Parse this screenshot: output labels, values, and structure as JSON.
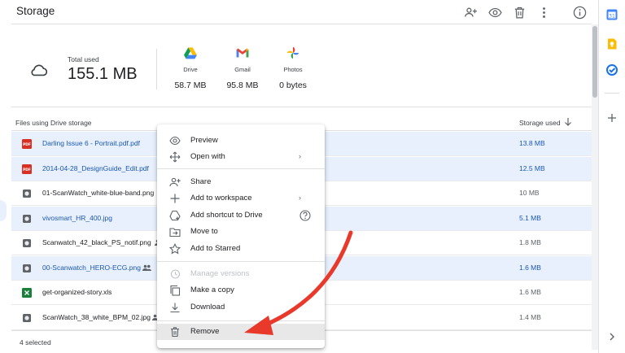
{
  "header": {
    "title": "Storage"
  },
  "summary": {
    "total_label": "Total used",
    "total_value": "155.1 MB",
    "services": [
      {
        "name": "Drive",
        "value": "58.7 MB",
        "icon": "google-drive-icon"
      },
      {
        "name": "Gmail",
        "value": "95.8 MB",
        "icon": "gmail-icon"
      },
      {
        "name": "Photos",
        "value": "0 bytes",
        "icon": "google-photos-icon"
      }
    ]
  },
  "table": {
    "col_files": "Files using Drive storage",
    "col_storage": "Storage used",
    "rows": [
      {
        "name": "Darling Issue 6 - Portrait.pdf.pdf",
        "size": "13.8 MB",
        "selected": true,
        "icon": "pdf-icon",
        "shared": false
      },
      {
        "name": "2014-04-28_DesignGuide_Edit.pdf",
        "size": "12.5 MB",
        "selected": true,
        "icon": "pdf-icon",
        "shared": false
      },
      {
        "name": "01-ScanWatch_white-blue-band.png",
        "size": "10 MB",
        "selected": false,
        "icon": "image-icon",
        "shared": true
      },
      {
        "name": "vivosmart_HR_400.jpg",
        "size": "5.1 MB",
        "selected": true,
        "icon": "image-icon",
        "shared": false
      },
      {
        "name": "Scanwatch_42_black_PS_notif.png",
        "size": "1.8 MB",
        "selected": false,
        "icon": "image-icon",
        "shared": true
      },
      {
        "name": "00-Scanwatch_HERO-ECG.png",
        "size": "1.6 MB",
        "selected": true,
        "icon": "image-icon",
        "shared": true
      },
      {
        "name": "get-organized-story.xls",
        "size": "1.6 MB",
        "selected": false,
        "icon": "sheets-icon",
        "shared": false
      },
      {
        "name": "ScanWatch_38_white_BPM_02.jpg",
        "size": "1.4 MB",
        "selected": false,
        "icon": "image-icon",
        "shared": true
      }
    ]
  },
  "status": {
    "selected_count": "4 selected"
  },
  "context_menu": {
    "items": [
      {
        "label": "Preview",
        "icon": "preview-eye-icon"
      },
      {
        "label": "Open with",
        "icon": "open-with-icon",
        "submenu": "›"
      },
      {
        "label": "Share",
        "icon": "share-person-add-icon"
      },
      {
        "label": "Add to workspace",
        "icon": "add-plus-icon",
        "submenu": "›"
      },
      {
        "label": "Add shortcut to Drive",
        "icon": "add-shortcut-icon",
        "help": true
      },
      {
        "label": "Move to",
        "icon": "move-to-folder-icon"
      },
      {
        "label": "Add to Starred",
        "icon": "star-icon"
      },
      {
        "label": "Manage versions",
        "icon": "history-icon",
        "disabled": true
      },
      {
        "label": "Make a copy",
        "icon": "copy-icon"
      },
      {
        "label": "Download",
        "icon": "download-icon"
      },
      {
        "label": "Remove",
        "icon": "trash-icon",
        "highlighted": true
      }
    ]
  },
  "colors": {
    "accent_blue": "#1a73e8",
    "selected_row": "#e8f0fe",
    "selected_text": "#1a57b5",
    "annotation_red": "#e8392b",
    "pdf_red": "#d93025",
    "sheets_green": "#188038"
  }
}
